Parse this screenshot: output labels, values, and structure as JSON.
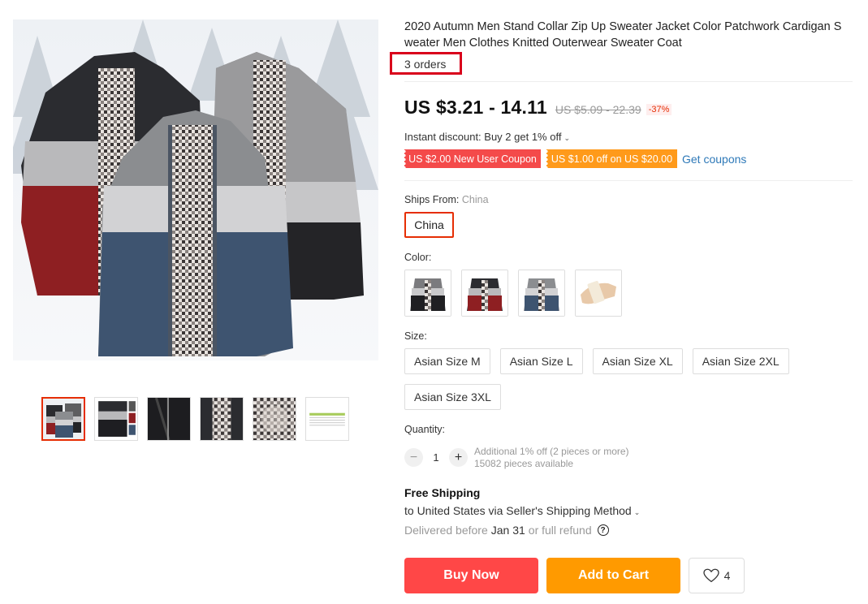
{
  "product": {
    "title": "2020 Autumn Men Stand Collar Zip Up Sweater Jacket Color Patchwork Cardigan Sweater Men Clothes Knitted Outerwear Sweater Coat",
    "orders": "3 orders"
  },
  "price": {
    "current": "US $3.21 - 14.11",
    "original": "US $5.09 - 22.39",
    "discount": "-37%"
  },
  "promo": {
    "instant_discount": "Instant discount: Buy 2 get 1% off",
    "coupon_new_user": "US $2.00 New User Coupon",
    "coupon_spend": "US $1.00 off on US $20.00",
    "get_coupons": "Get coupons"
  },
  "shipping_from": {
    "label": "Ships From:",
    "value": "China",
    "option": "China"
  },
  "color": {
    "label": "Color:"
  },
  "size": {
    "label": "Size:",
    "options": [
      "Asian Size M",
      "Asian Size L",
      "Asian Size XL",
      "Asian Size 2XL",
      "Asian Size 3XL"
    ]
  },
  "quantity": {
    "label": "Quantity:",
    "minus": "−",
    "plus": "+",
    "value": "1",
    "note": "Additional 1% off (2 pieces or more)",
    "available": "15082 pieces available"
  },
  "delivery": {
    "free_shipping": "Free Shipping",
    "ship_to": "to United States via Seller's Shipping Method",
    "delivered_before": "Delivered before",
    "date": "Jan 31",
    "refund": "or full refund",
    "help": "?"
  },
  "actions": {
    "buy_now": "Buy Now",
    "add_to_cart": "Add to Cart",
    "wishlist_count": "4"
  },
  "colors": {
    "accent_red": "#ff4747",
    "accent_orange": "#ff9a00",
    "link_blue": "#2e79b8",
    "highlight_box": "#d9001b"
  }
}
